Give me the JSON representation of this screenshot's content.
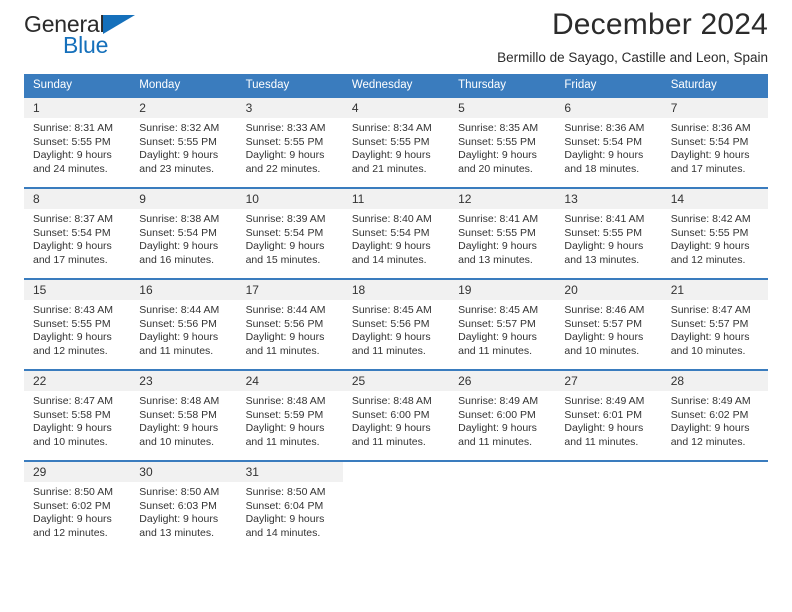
{
  "brand": {
    "name_top": "General",
    "name_bottom": "Blue",
    "triangle_color": "#1570bb"
  },
  "header": {
    "title": "December 2024",
    "subtitle": "Bermillo de Sayago, Castille and Leon, Spain"
  },
  "theme": {
    "header_bg": "#3a7cbe",
    "header_text": "#ffffff",
    "daynum_bg": "#f1f1f1",
    "body_text": "#333333"
  },
  "weekday_headers": [
    "Sunday",
    "Monday",
    "Tuesday",
    "Wednesday",
    "Thursday",
    "Friday",
    "Saturday"
  ],
  "weeks": [
    [
      {
        "day": "1",
        "sunrise": "Sunrise: 8:31 AM",
        "sunset": "Sunset: 5:55 PM",
        "daylight_1": "Daylight: 9 hours",
        "daylight_2": "and 24 minutes."
      },
      {
        "day": "2",
        "sunrise": "Sunrise: 8:32 AM",
        "sunset": "Sunset: 5:55 PM",
        "daylight_1": "Daylight: 9 hours",
        "daylight_2": "and 23 minutes."
      },
      {
        "day": "3",
        "sunrise": "Sunrise: 8:33 AM",
        "sunset": "Sunset: 5:55 PM",
        "daylight_1": "Daylight: 9 hours",
        "daylight_2": "and 22 minutes."
      },
      {
        "day": "4",
        "sunrise": "Sunrise: 8:34 AM",
        "sunset": "Sunset: 5:55 PM",
        "daylight_1": "Daylight: 9 hours",
        "daylight_2": "and 21 minutes."
      },
      {
        "day": "5",
        "sunrise": "Sunrise: 8:35 AM",
        "sunset": "Sunset: 5:55 PM",
        "daylight_1": "Daylight: 9 hours",
        "daylight_2": "and 20 minutes."
      },
      {
        "day": "6",
        "sunrise": "Sunrise: 8:36 AM",
        "sunset": "Sunset: 5:54 PM",
        "daylight_1": "Daylight: 9 hours",
        "daylight_2": "and 18 minutes."
      },
      {
        "day": "7",
        "sunrise": "Sunrise: 8:36 AM",
        "sunset": "Sunset: 5:54 PM",
        "daylight_1": "Daylight: 9 hours",
        "daylight_2": "and 17 minutes."
      }
    ],
    [
      {
        "day": "8",
        "sunrise": "Sunrise: 8:37 AM",
        "sunset": "Sunset: 5:54 PM",
        "daylight_1": "Daylight: 9 hours",
        "daylight_2": "and 17 minutes."
      },
      {
        "day": "9",
        "sunrise": "Sunrise: 8:38 AM",
        "sunset": "Sunset: 5:54 PM",
        "daylight_1": "Daylight: 9 hours",
        "daylight_2": "and 16 minutes."
      },
      {
        "day": "10",
        "sunrise": "Sunrise: 8:39 AM",
        "sunset": "Sunset: 5:54 PM",
        "daylight_1": "Daylight: 9 hours",
        "daylight_2": "and 15 minutes."
      },
      {
        "day": "11",
        "sunrise": "Sunrise: 8:40 AM",
        "sunset": "Sunset: 5:54 PM",
        "daylight_1": "Daylight: 9 hours",
        "daylight_2": "and 14 minutes."
      },
      {
        "day": "12",
        "sunrise": "Sunrise: 8:41 AM",
        "sunset": "Sunset: 5:55 PM",
        "daylight_1": "Daylight: 9 hours",
        "daylight_2": "and 13 minutes."
      },
      {
        "day": "13",
        "sunrise": "Sunrise: 8:41 AM",
        "sunset": "Sunset: 5:55 PM",
        "daylight_1": "Daylight: 9 hours",
        "daylight_2": "and 13 minutes."
      },
      {
        "day": "14",
        "sunrise": "Sunrise: 8:42 AM",
        "sunset": "Sunset: 5:55 PM",
        "daylight_1": "Daylight: 9 hours",
        "daylight_2": "and 12 minutes."
      }
    ],
    [
      {
        "day": "15",
        "sunrise": "Sunrise: 8:43 AM",
        "sunset": "Sunset: 5:55 PM",
        "daylight_1": "Daylight: 9 hours",
        "daylight_2": "and 12 minutes."
      },
      {
        "day": "16",
        "sunrise": "Sunrise: 8:44 AM",
        "sunset": "Sunset: 5:56 PM",
        "daylight_1": "Daylight: 9 hours",
        "daylight_2": "and 11 minutes."
      },
      {
        "day": "17",
        "sunrise": "Sunrise: 8:44 AM",
        "sunset": "Sunset: 5:56 PM",
        "daylight_1": "Daylight: 9 hours",
        "daylight_2": "and 11 minutes."
      },
      {
        "day": "18",
        "sunrise": "Sunrise: 8:45 AM",
        "sunset": "Sunset: 5:56 PM",
        "daylight_1": "Daylight: 9 hours",
        "daylight_2": "and 11 minutes."
      },
      {
        "day": "19",
        "sunrise": "Sunrise: 8:45 AM",
        "sunset": "Sunset: 5:57 PM",
        "daylight_1": "Daylight: 9 hours",
        "daylight_2": "and 11 minutes."
      },
      {
        "day": "20",
        "sunrise": "Sunrise: 8:46 AM",
        "sunset": "Sunset: 5:57 PM",
        "daylight_1": "Daylight: 9 hours",
        "daylight_2": "and 10 minutes."
      },
      {
        "day": "21",
        "sunrise": "Sunrise: 8:47 AM",
        "sunset": "Sunset: 5:57 PM",
        "daylight_1": "Daylight: 9 hours",
        "daylight_2": "and 10 minutes."
      }
    ],
    [
      {
        "day": "22",
        "sunrise": "Sunrise: 8:47 AM",
        "sunset": "Sunset: 5:58 PM",
        "daylight_1": "Daylight: 9 hours",
        "daylight_2": "and 10 minutes."
      },
      {
        "day": "23",
        "sunrise": "Sunrise: 8:48 AM",
        "sunset": "Sunset: 5:58 PM",
        "daylight_1": "Daylight: 9 hours",
        "daylight_2": "and 10 minutes."
      },
      {
        "day": "24",
        "sunrise": "Sunrise: 8:48 AM",
        "sunset": "Sunset: 5:59 PM",
        "daylight_1": "Daylight: 9 hours",
        "daylight_2": "and 11 minutes."
      },
      {
        "day": "25",
        "sunrise": "Sunrise: 8:48 AM",
        "sunset": "Sunset: 6:00 PM",
        "daylight_1": "Daylight: 9 hours",
        "daylight_2": "and 11 minutes."
      },
      {
        "day": "26",
        "sunrise": "Sunrise: 8:49 AM",
        "sunset": "Sunset: 6:00 PM",
        "daylight_1": "Daylight: 9 hours",
        "daylight_2": "and 11 minutes."
      },
      {
        "day": "27",
        "sunrise": "Sunrise: 8:49 AM",
        "sunset": "Sunset: 6:01 PM",
        "daylight_1": "Daylight: 9 hours",
        "daylight_2": "and 11 minutes."
      },
      {
        "day": "28",
        "sunrise": "Sunrise: 8:49 AM",
        "sunset": "Sunset: 6:02 PM",
        "daylight_1": "Daylight: 9 hours",
        "daylight_2": "and 12 minutes."
      }
    ],
    [
      {
        "day": "29",
        "sunrise": "Sunrise: 8:50 AM",
        "sunset": "Sunset: 6:02 PM",
        "daylight_1": "Daylight: 9 hours",
        "daylight_2": "and 12 minutes."
      },
      {
        "day": "30",
        "sunrise": "Sunrise: 8:50 AM",
        "sunset": "Sunset: 6:03 PM",
        "daylight_1": "Daylight: 9 hours",
        "daylight_2": "and 13 minutes."
      },
      {
        "day": "31",
        "sunrise": "Sunrise: 8:50 AM",
        "sunset": "Sunset: 6:04 PM",
        "daylight_1": "Daylight: 9 hours",
        "daylight_2": "and 14 minutes."
      },
      {
        "day": "",
        "sunrise": "",
        "sunset": "",
        "daylight_1": "",
        "daylight_2": ""
      },
      {
        "day": "",
        "sunrise": "",
        "sunset": "",
        "daylight_1": "",
        "daylight_2": ""
      },
      {
        "day": "",
        "sunrise": "",
        "sunset": "",
        "daylight_1": "",
        "daylight_2": ""
      },
      {
        "day": "",
        "sunrise": "",
        "sunset": "",
        "daylight_1": "",
        "daylight_2": ""
      }
    ]
  ]
}
